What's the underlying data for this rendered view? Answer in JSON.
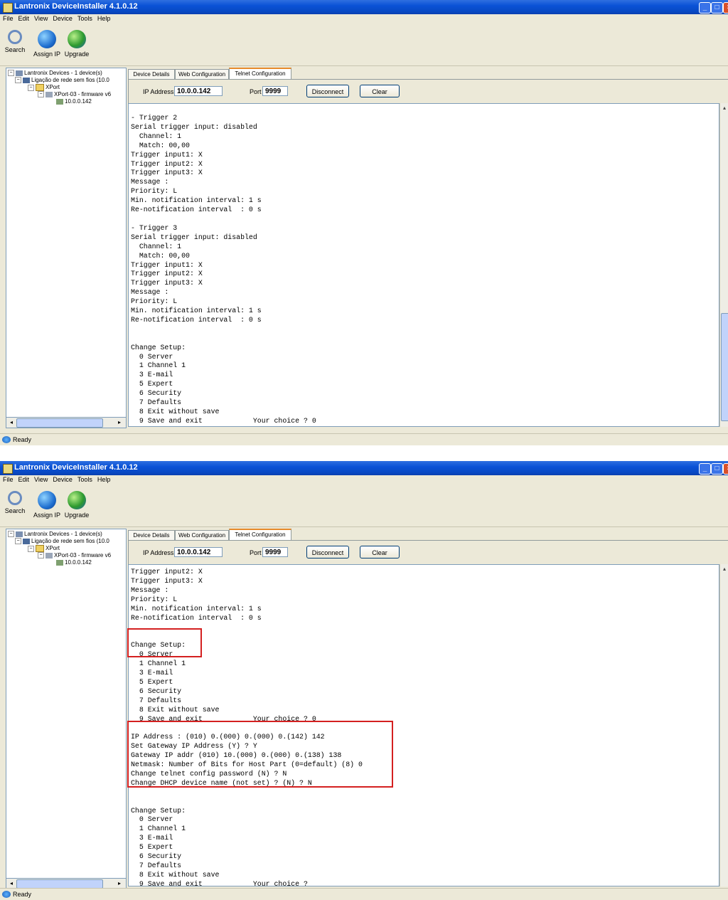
{
  "app": {
    "title": "Lantronix DeviceInstaller 4.1.0.12",
    "menus": [
      "File",
      "Edit",
      "View",
      "Device",
      "Tools",
      "Help"
    ],
    "toolbar": [
      {
        "label": "Search",
        "icon": "search-icon"
      },
      {
        "label": "Assign IP",
        "icon": "assign-ip-icon"
      },
      {
        "label": "Upgrade",
        "icon": "upgrade-icon"
      }
    ],
    "tree": {
      "root": "Lantronix Devices - 1 device(s)",
      "network": "Ligação de rede sem fios (10.0",
      "group": "XPort",
      "device": "XPort-03 - firmware v6",
      "ip": "10.0.0.142"
    },
    "tabs": [
      "Device Details",
      "Web Configuration",
      "Telnet Configuration"
    ],
    "active_tab": "Telnet Configuration",
    "connection": {
      "ip_label": "IP Address",
      "ip_value": "10.0.0.142",
      "port_label": "Port",
      "port_value": "9999",
      "disconnect": "Disconnect",
      "clear": "Clear"
    },
    "status": "Ready"
  },
  "screen1": {
    "console_text": "- Trigger 2\nSerial trigger input: disabled\n  Channel: 1\n  Match: 00,00\nTrigger input1: X\nTrigger input2: X\nTrigger input3: X\nMessage :\nPriority: L\nMin. notification interval: 1 s\nRe-notification interval  : 0 s\n\n- Trigger 3\nSerial trigger input: disabled\n  Channel: 1\n  Match: 00,00\nTrigger input1: X\nTrigger input2: X\nTrigger input3: X\nMessage :\nPriority: L\nMin. notification interval: 1 s\nRe-notification interval  : 0 s\n\n\nChange Setup:\n  0 Server\n  1 Channel 1\n  3 E-mail\n  5 Expert\n  6 Security\n  7 Defaults\n  8 Exit without save\n  9 Save and exit            Your choice ? 0"
  },
  "screen2": {
    "console_text": "Trigger input2: X\nTrigger input3: X\nMessage :\nPriority: L\nMin. notification interval: 1 s\nRe-notification interval  : 0 s\n\n\nChange Setup:\n  0 Server\n  1 Channel 1\n  3 E-mail\n  5 Expert\n  6 Security\n  7 Defaults\n  8 Exit without save\n  9 Save and exit            Your choice ? 0\n\nIP Address : (010) 0.(000) 0.(000) 0.(142) 142\nSet Gateway IP Address (Y) ? Y\nGateway IP addr (010) 10.(000) 0.(000) 0.(138) 138\nNetmask: Number of Bits for Host Part (0=default) (8) 0\nChange telnet config password (N) ? N\nChange DHCP device name (not set) ? (N) ? N\n\n\nChange Setup:\n  0 Server\n  1 Channel 1\n  3 E-mail\n  5 Expert\n  6 Security\n  7 Defaults\n  8 Exit without save\n  9 Save and exit            Your choice ?"
  },
  "colors": {
    "highlight": "#d42020",
    "titlebar": "#0a52d6",
    "active_tab": "#e68b2c"
  }
}
